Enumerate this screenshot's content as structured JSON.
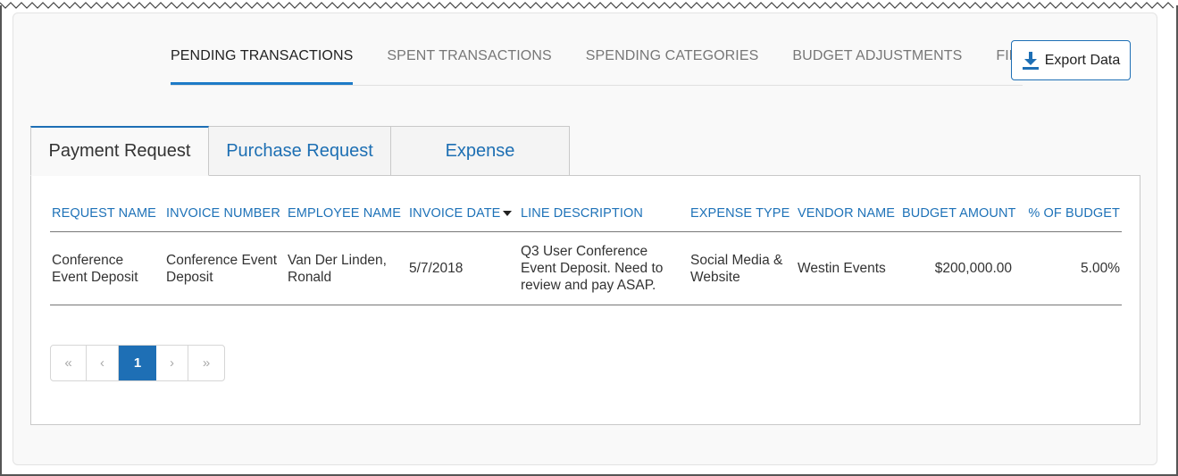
{
  "top_tabs": [
    {
      "label": "PENDING TRANSACTIONS",
      "active": true
    },
    {
      "label": "SPENT TRANSACTIONS",
      "active": false
    },
    {
      "label": "SPENDING CATEGORIES",
      "active": false
    },
    {
      "label": "BUDGET ADJUSTMENTS",
      "active": false
    },
    {
      "label": "FILTERS",
      "active": false
    }
  ],
  "export": {
    "label": "Export Data",
    "icon": "download-icon"
  },
  "sub_tabs": [
    {
      "label": "Payment Request",
      "active": true
    },
    {
      "label": "Purchase Request",
      "active": false
    },
    {
      "label": "Expense",
      "active": false
    }
  ],
  "table": {
    "columns": [
      "REQUEST NAME",
      "INVOICE NUMBER",
      "EMPLOYEE NAME",
      "INVOICE DATE",
      "LINE DESCRIPTION",
      "EXPENSE TYPE",
      "VENDOR NAME",
      "BUDGET AMOUNT",
      "% OF BUDGET"
    ],
    "sorted_column": "INVOICE DATE",
    "sort_direction": "descending",
    "rows": [
      {
        "request_name": "Conference Event Deposit",
        "invoice_number": "Conference Event Deposit",
        "employee_name": "Van Der Linden, Ronald",
        "invoice_date": "5/7/2018",
        "line_description": "Q3 User Conference Event Deposit. Need to review and pay ASAP.",
        "expense_type": "Social Media & Website",
        "vendor_name": "Westin Events",
        "budget_amount": "$200,000.00",
        "pct_of_budget": "5.00%"
      }
    ]
  },
  "pagination": {
    "first": "«",
    "prev": "‹",
    "current": "1",
    "next": "›",
    "last": "»"
  },
  "colors": {
    "accent": "#1e72b8",
    "active_page": "#1e6fb5"
  }
}
